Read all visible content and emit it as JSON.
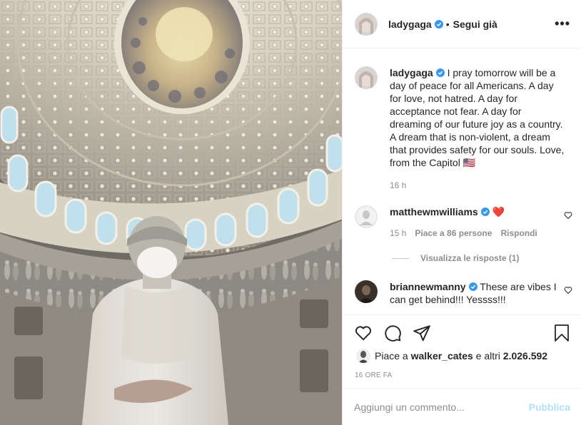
{
  "post": {
    "username": "ladygaga",
    "dot": "•",
    "follow_label": "Segui già",
    "more_label": "•••"
  },
  "caption": {
    "username": "ladygaga",
    "text": "I pray tomorrow will be a day of peace for all Americans. A day for love, not hatred. A day for acceptance not fear. A day for dreaming of our future joy as a country. A dream that is non-violent, a dream that provides safety for our souls. Love, from the Capitol 🇺🇸",
    "time": "16 h"
  },
  "comments": [
    {
      "username": "matthewmwilliams",
      "text": "❤️",
      "time": "15 h",
      "likes": "Piace a 86 persone",
      "reply": "Rispondi",
      "view_replies": "Visualizza le risposte (1)"
    },
    {
      "username": "briannewmanny",
      "text": "These are vibes I can get behind!!! Yessss!!!"
    }
  ],
  "likes": {
    "prefix": "Piace a",
    "user": "walker_cates",
    "mid": "e altri",
    "count": "2.026.592"
  },
  "date": "16 ORE FA",
  "add_comment": {
    "placeholder": "Aggiungi un commento...",
    "publish_label": "Pubblica"
  },
  "colors": {
    "verified": "#3897f0",
    "link_disabled": "#b2dffc",
    "secondary_text": "#8e8e8e"
  },
  "icons": {
    "like": "heart-icon",
    "comment": "comment-icon",
    "share": "paper-plane-icon",
    "save": "bookmark-icon",
    "more": "more-dots-icon"
  }
}
